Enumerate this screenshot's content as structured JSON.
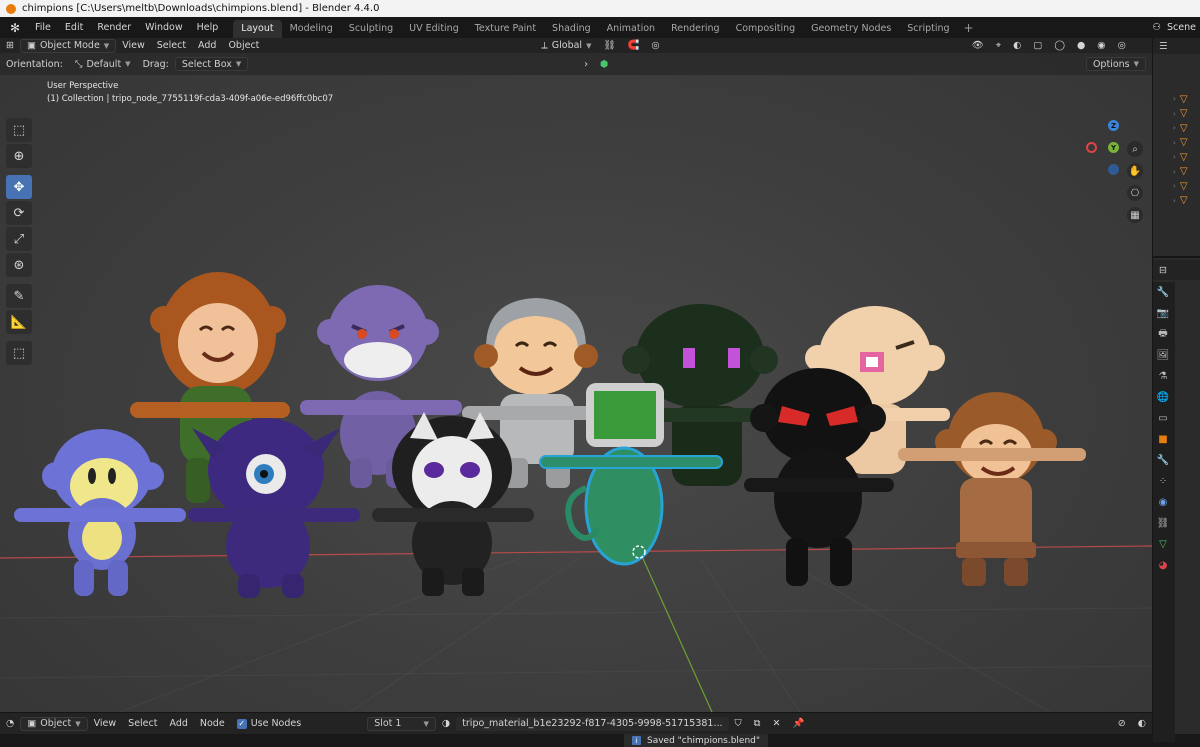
{
  "window": {
    "title": "chimpions [C:\\Users\\meltb\\Downloads\\chimpions.blend] - Blender 4.4.0"
  },
  "menu": [
    "File",
    "Edit",
    "Render",
    "Window",
    "Help"
  ],
  "workspaces": [
    "Layout",
    "Modeling",
    "Sculpting",
    "UV Editing",
    "Texture Paint",
    "Shading",
    "Animation",
    "Rendering",
    "Compositing",
    "Geometry Nodes",
    "Scripting"
  ],
  "active_workspace": "Layout",
  "scene_label": "Scene",
  "viewport": {
    "mode": "Object Mode",
    "menu": [
      "View",
      "Select",
      "Add",
      "Object"
    ],
    "transform_orientation": "Global",
    "orientation_label": "Orientation:",
    "orientation_value": "Default",
    "drag_label": "Drag:",
    "drag_value": "Select Box",
    "options_label": "Options",
    "perspective": "User Perspective",
    "collection_info": "(1) Collection | tripo_node_7755119f-cda3-409f-a06e-ed96ffc0bc07"
  },
  "gizmo": {
    "z": "Z",
    "x": "X",
    "y": "Y",
    "colors": {
      "x": "#e0424b",
      "y": "#79b33a",
      "z": "#3c84d9"
    }
  },
  "node_header": {
    "type": "Object",
    "menu": [
      "View",
      "Select",
      "Add",
      "Node"
    ],
    "use_nodes_label": "Use Nodes",
    "use_nodes": true,
    "slot": "Slot 1",
    "material": "tripo_material_b1e23292-f817-4305-9998-51715381..."
  },
  "status": {
    "message": "Saved \"chimpions.blend\""
  },
  "accent": "#4772b3"
}
